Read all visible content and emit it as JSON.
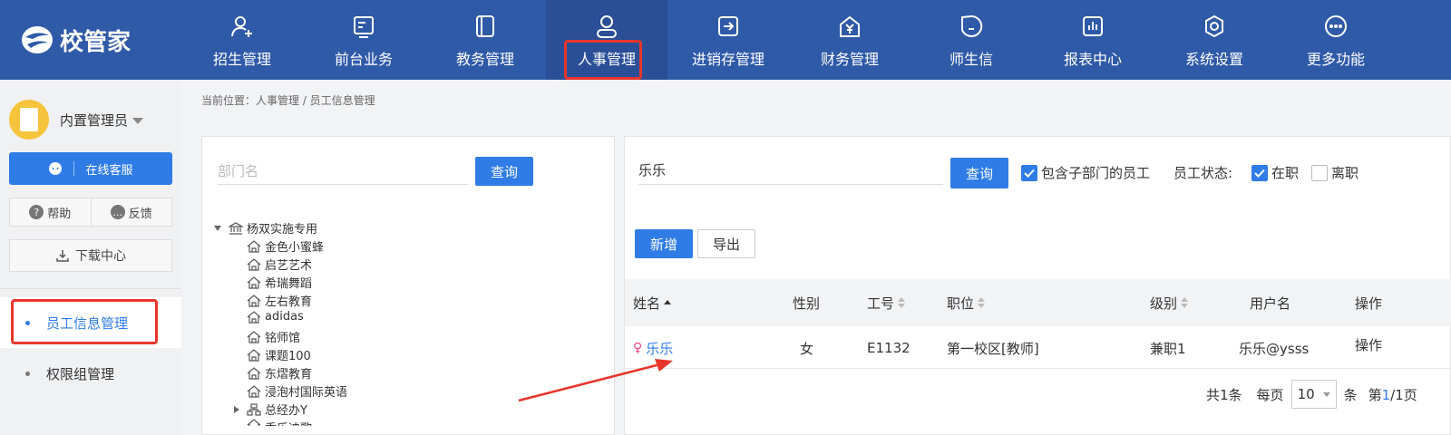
{
  "logo": {
    "text": "校管家"
  },
  "nav": {
    "items": [
      {
        "label": "招生管理",
        "icon": "user-plus-icon"
      },
      {
        "label": "前台业务",
        "icon": "monitor-icon"
      },
      {
        "label": "教务管理",
        "icon": "book-icon"
      },
      {
        "label": "人事管理",
        "icon": "person-icon",
        "active": true
      },
      {
        "label": "进销存管理",
        "icon": "box-arrow-icon"
      },
      {
        "label": "财务管理",
        "icon": "yen-house-icon"
      },
      {
        "label": "师生信",
        "icon": "chat-icon"
      },
      {
        "label": "报表中心",
        "icon": "bar-chart-icon"
      },
      {
        "label": "系统设置",
        "icon": "gear-icon"
      },
      {
        "label": "更多功能",
        "icon": "more-icon"
      }
    ]
  },
  "sidebar": {
    "user_name": "内置管理员",
    "service_label": "在线客服",
    "help_label": "帮助",
    "feedback_label": "反馈",
    "download_label": "下载中心",
    "items": [
      {
        "label": "员工信息管理",
        "active": true
      },
      {
        "label": "权限组管理"
      }
    ]
  },
  "breadcrumb": "当前位置：人事管理 / 员工信息管理",
  "dept": {
    "placeholder": "部门名",
    "query_label": "查询",
    "tree": {
      "root": "杨双实施专用",
      "children": [
        "金色小蜜蜂",
        "启艺艺术",
        "希瑞舞蹈",
        "左右教育",
        "adidas",
        "铭师馆",
        "课题100",
        "东熠教育",
        "浸泡村国际英语"
      ],
      "collapsed_group": "总经办Y",
      "partial": "香乐迪歌"
    }
  },
  "employee": {
    "search_value": "乐乐",
    "query_label": "查询",
    "include_sub_label": "包含子部门的员工",
    "status_label": "员工状态:",
    "status_active_label": "在职",
    "status_left_label": "离职",
    "add_label": "新增",
    "export_label": "导出",
    "columns": [
      "姓名",
      "性别",
      "工号",
      "职位",
      "级别",
      "用户名",
      "操作"
    ],
    "rows": [
      {
        "name": "乐乐",
        "gender": "女",
        "id": "E1132",
        "position": "第一校区[教师]",
        "level": "兼职1",
        "username": "乐乐@ysss",
        "action": "操作"
      }
    ],
    "pager": {
      "total": "共1条",
      "per_page_label": "每页",
      "per_page": "10",
      "unit": "条",
      "page_prefix": "第",
      "page_current": "1",
      "page_rest": "/1页"
    }
  },
  "colors": {
    "nav_bg": "#2f5aa8",
    "primary": "#2f7ce6",
    "highlight": "#e8352c"
  }
}
